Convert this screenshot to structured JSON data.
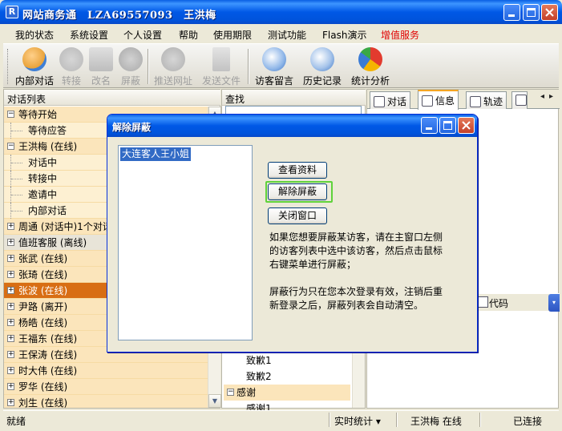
{
  "window": {
    "title": "网站商务通　LZA69557093　王洪梅",
    "app_icon_glyph": "R"
  },
  "menu": [
    "我的状态",
    "系统设置",
    "个人设置",
    "帮助",
    "使用期限",
    "测试功能",
    "Flash演示",
    "增值服务"
  ],
  "colors": {
    "menu_highlight": "#e00000",
    "tree_background": "#FBE5BB",
    "tree_selected": "#D86E14",
    "list_selected": "#316AC5",
    "focus_border": "#5fd23b"
  },
  "toolbar": [
    {
      "label": "内部对话",
      "icon": "chat-users-icon",
      "disabled": false
    },
    {
      "label": "转接",
      "icon": "transfer-icon",
      "disabled": true
    },
    {
      "label": "改名",
      "icon": "rename-icon",
      "disabled": true
    },
    {
      "label": "屏蔽",
      "icon": "block-icon",
      "disabled": true
    },
    {
      "label": "推送网址",
      "icon": "push-url-icon",
      "disabled": true
    },
    {
      "label": "发送文件",
      "icon": "send-file-icon",
      "disabled": true
    },
    {
      "label": "访客留言",
      "icon": "visitor-message-icon",
      "disabled": false
    },
    {
      "label": "历史记录",
      "icon": "history-icon",
      "disabled": false
    },
    {
      "label": "统计分析",
      "icon": "statistics-icon",
      "disabled": false
    }
  ],
  "left_panel": {
    "header": "对话列表",
    "tree": [
      {
        "label": "等待开始",
        "type": "group",
        "expander": "⊟"
      },
      {
        "label": "等待应答",
        "type": "child"
      },
      {
        "label": "王洪梅 (在线)",
        "type": "group",
        "expander": "⊟"
      },
      {
        "label": "对话中",
        "type": "child"
      },
      {
        "label": "转接中",
        "type": "child"
      },
      {
        "label": "邀请中",
        "type": "child"
      },
      {
        "label": "内部对话",
        "type": "child"
      },
      {
        "label": "周通 (对话中)1个对话",
        "type": "group",
        "expander": "⊞"
      },
      {
        "label": "值班客服 (离线)",
        "type": "group",
        "expander": "⊞",
        "gray": true
      },
      {
        "label": "张武 (在线)",
        "type": "group",
        "expander": "⊞"
      },
      {
        "label": "张琦 (在线)",
        "type": "group",
        "expander": "⊞"
      },
      {
        "label": "张波 (在线)",
        "type": "group",
        "expander": "⊞",
        "selected": true
      },
      {
        "label": "尹路 (离开)",
        "type": "group",
        "expander": "⊞"
      },
      {
        "label": "杨皓 (在线)",
        "type": "group",
        "expander": "⊞"
      },
      {
        "label": "王福东 (在线)",
        "type": "group",
        "expander": "⊞"
      },
      {
        "label": "王保涛 (在线)",
        "type": "group",
        "expander": "⊞"
      },
      {
        "label": "时大伟 (在线)",
        "type": "group",
        "expander": "⊞"
      },
      {
        "label": "罗华 (在线)",
        "type": "group",
        "expander": "⊞"
      },
      {
        "label": "刘生 (在线)",
        "type": "group",
        "expander": "⊞"
      }
    ]
  },
  "middle_panel": {
    "header": "查找",
    "items": [
      {
        "label": "致歉1",
        "type": "child"
      },
      {
        "label": "致歉2",
        "type": "child"
      },
      {
        "label": "感谢",
        "type": "group"
      },
      {
        "label": "感谢1",
        "type": "child"
      }
    ]
  },
  "right_panel": {
    "tabs": [
      {
        "label": "对话",
        "icon": "chat-tab-icon"
      },
      {
        "label": "信息",
        "icon": "info-tab-icon",
        "active": true
      },
      {
        "label": "轨迹",
        "icon": "track-tab-icon"
      }
    ],
    "code_label": "代码"
  },
  "statusbar": {
    "status": "就绪",
    "stats": "实时统计 ▾",
    "user": "王洪梅 在线",
    "connection": "已连接"
  },
  "dialog": {
    "title": "解除屏蔽",
    "list_items": [
      "大连客人王小姐"
    ],
    "buttons": {
      "view_profile": "查看资料",
      "unblock": "解除屏蔽",
      "close": "关闭窗口"
    },
    "help_text_1": "如果您想要屏蔽某访客，请在主窗口左侧\n的访客列表中选中该访客，然后点击鼠标\n右键菜单进行屏蔽；",
    "help_text_2": "屏蔽行为只在您本次登录有效，注销后重\n新登录之后，屏蔽列表会自动清空。"
  }
}
